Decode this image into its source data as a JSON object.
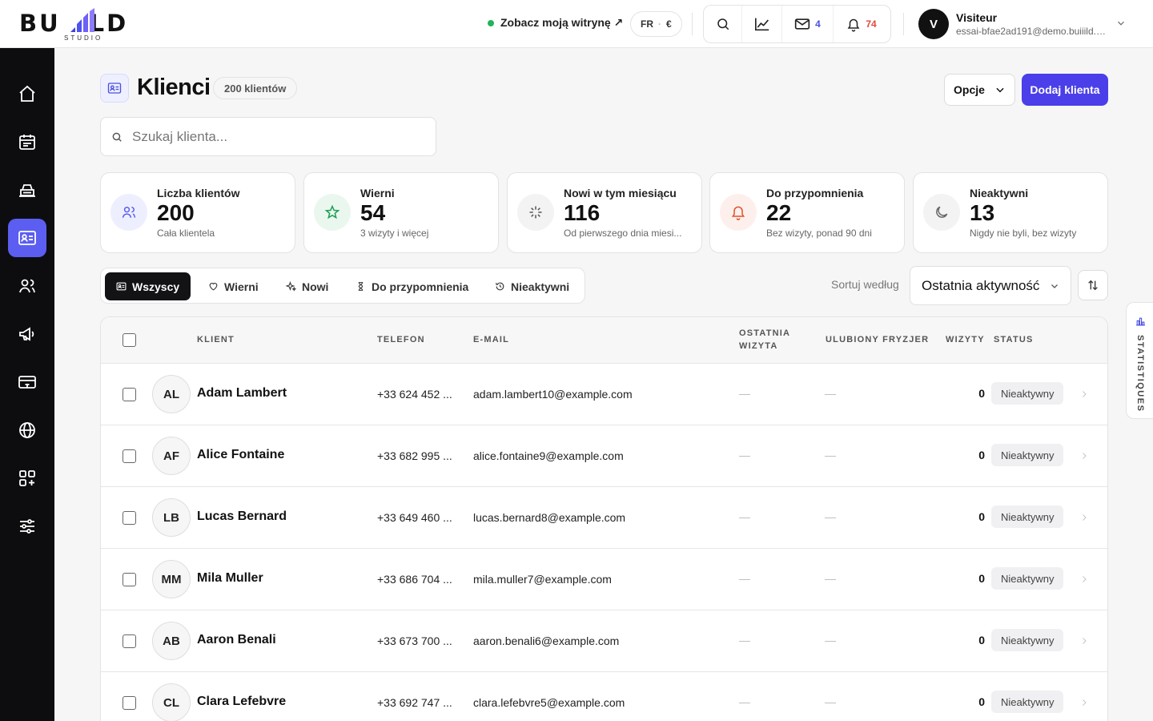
{
  "brand": {
    "logo_text": "BUILD",
    "logo_sub": "STUDIO"
  },
  "topbar": {
    "site_link": "Zobacz moją witrynę ↗",
    "lang": "FR",
    "currency": "€",
    "messages_count": "4",
    "notifications_count": "74",
    "user": {
      "initial": "V",
      "name": "Visiteur",
      "email": "essai-bfae2ad191@demo.buiiild.c..."
    }
  },
  "sidebar": {
    "items": [
      {
        "icon": "home-icon"
      },
      {
        "icon": "calendar-icon"
      },
      {
        "icon": "register-icon"
      },
      {
        "icon": "clients-card-icon",
        "active": true
      },
      {
        "icon": "team-icon"
      },
      {
        "icon": "megaphone-icon"
      },
      {
        "icon": "payment-card-icon"
      },
      {
        "icon": "globe-icon"
      },
      {
        "icon": "apps-grid-icon"
      },
      {
        "icon": "settings-sliders-icon"
      }
    ]
  },
  "page": {
    "title": "Klienci",
    "count_badge": "200 klientów",
    "options_label": "Opcje",
    "add_label": "Dodaj klienta",
    "search_placeholder": "Szukaj klienta..."
  },
  "stats": [
    {
      "label": "Liczba klientów",
      "value": "200",
      "sub": "Cała klientela",
      "icon": "users-icon",
      "color": "#5b5ef0"
    },
    {
      "label": "Wierni",
      "value": "54",
      "sub": "3 wizyty i więcej",
      "icon": "star-icon",
      "color": "#1f9d55"
    },
    {
      "label": "Nowi w tym miesiącu",
      "value": "116",
      "sub": "Od pierwszego dnia miesi...",
      "icon": "sparkle-icon",
      "color": "#555555"
    },
    {
      "label": "Do przypomnienia",
      "value": "22",
      "sub": "Bez wizyty, ponad 90 dni",
      "icon": "bell-icon",
      "color": "#e0522b"
    },
    {
      "label": "Nieaktywni",
      "value": "13",
      "sub": "Nigdy nie byli, bez wizyty",
      "icon": "moon-icon",
      "color": "#666666"
    }
  ],
  "filters": {
    "tabs": [
      {
        "label": "Wszyscy",
        "active": true
      },
      {
        "label": "Wierni"
      },
      {
        "label": "Nowi"
      },
      {
        "label": "Do przypomnienia"
      },
      {
        "label": "Nieaktywni"
      }
    ],
    "sort_label": "Sortuj według",
    "sort_value": "Ostatnia aktywność"
  },
  "table": {
    "headers": {
      "client": "KLIENT",
      "phone": "TELEFON",
      "email": "E-MAIL",
      "last_visit_1": "OSTATNIA",
      "last_visit_2": "WIZYTA",
      "favorite": "ULUBIONY FRYZJER",
      "visits": "WIZYTY",
      "status": "STATUS"
    },
    "rows": [
      {
        "initials": "AL",
        "name": "Adam Lambert",
        "phone": "+33 624 452 ...",
        "email": "adam.lambert10@example.com",
        "last_visit": "—",
        "favorite": "—",
        "visits": "0",
        "status": "Nieaktywny"
      },
      {
        "initials": "AF",
        "name": "Alice Fontaine",
        "phone": "+33 682 995 ...",
        "email": "alice.fontaine9@example.com",
        "last_visit": "—",
        "favorite": "—",
        "visits": "0",
        "status": "Nieaktywny"
      },
      {
        "initials": "LB",
        "name": "Lucas Bernard",
        "phone": "+33 649 460 ...",
        "email": "lucas.bernard8@example.com",
        "last_visit": "—",
        "favorite": "—",
        "visits": "0",
        "status": "Nieaktywny"
      },
      {
        "initials": "MM",
        "name": "Mila Muller",
        "phone": "+33 686 704 ...",
        "email": "mila.muller7@example.com",
        "last_visit": "—",
        "favorite": "—",
        "visits": "0",
        "status": "Nieaktywny"
      },
      {
        "initials": "AB",
        "name": "Aaron Benali",
        "phone": "+33 673 700 ...",
        "email": "aaron.benali6@example.com",
        "last_visit": "—",
        "favorite": "—",
        "visits": "0",
        "status": "Nieaktywny"
      },
      {
        "initials": "CL",
        "name": "Clara Lefebvre",
        "phone": "+33 692 747 ...",
        "email": "clara.lefebvre5@example.com",
        "last_visit": "—",
        "favorite": "—",
        "visits": "0",
        "status": "Nieaktywny"
      }
    ]
  },
  "side_panel": {
    "label": "STATISTIQUES"
  }
}
